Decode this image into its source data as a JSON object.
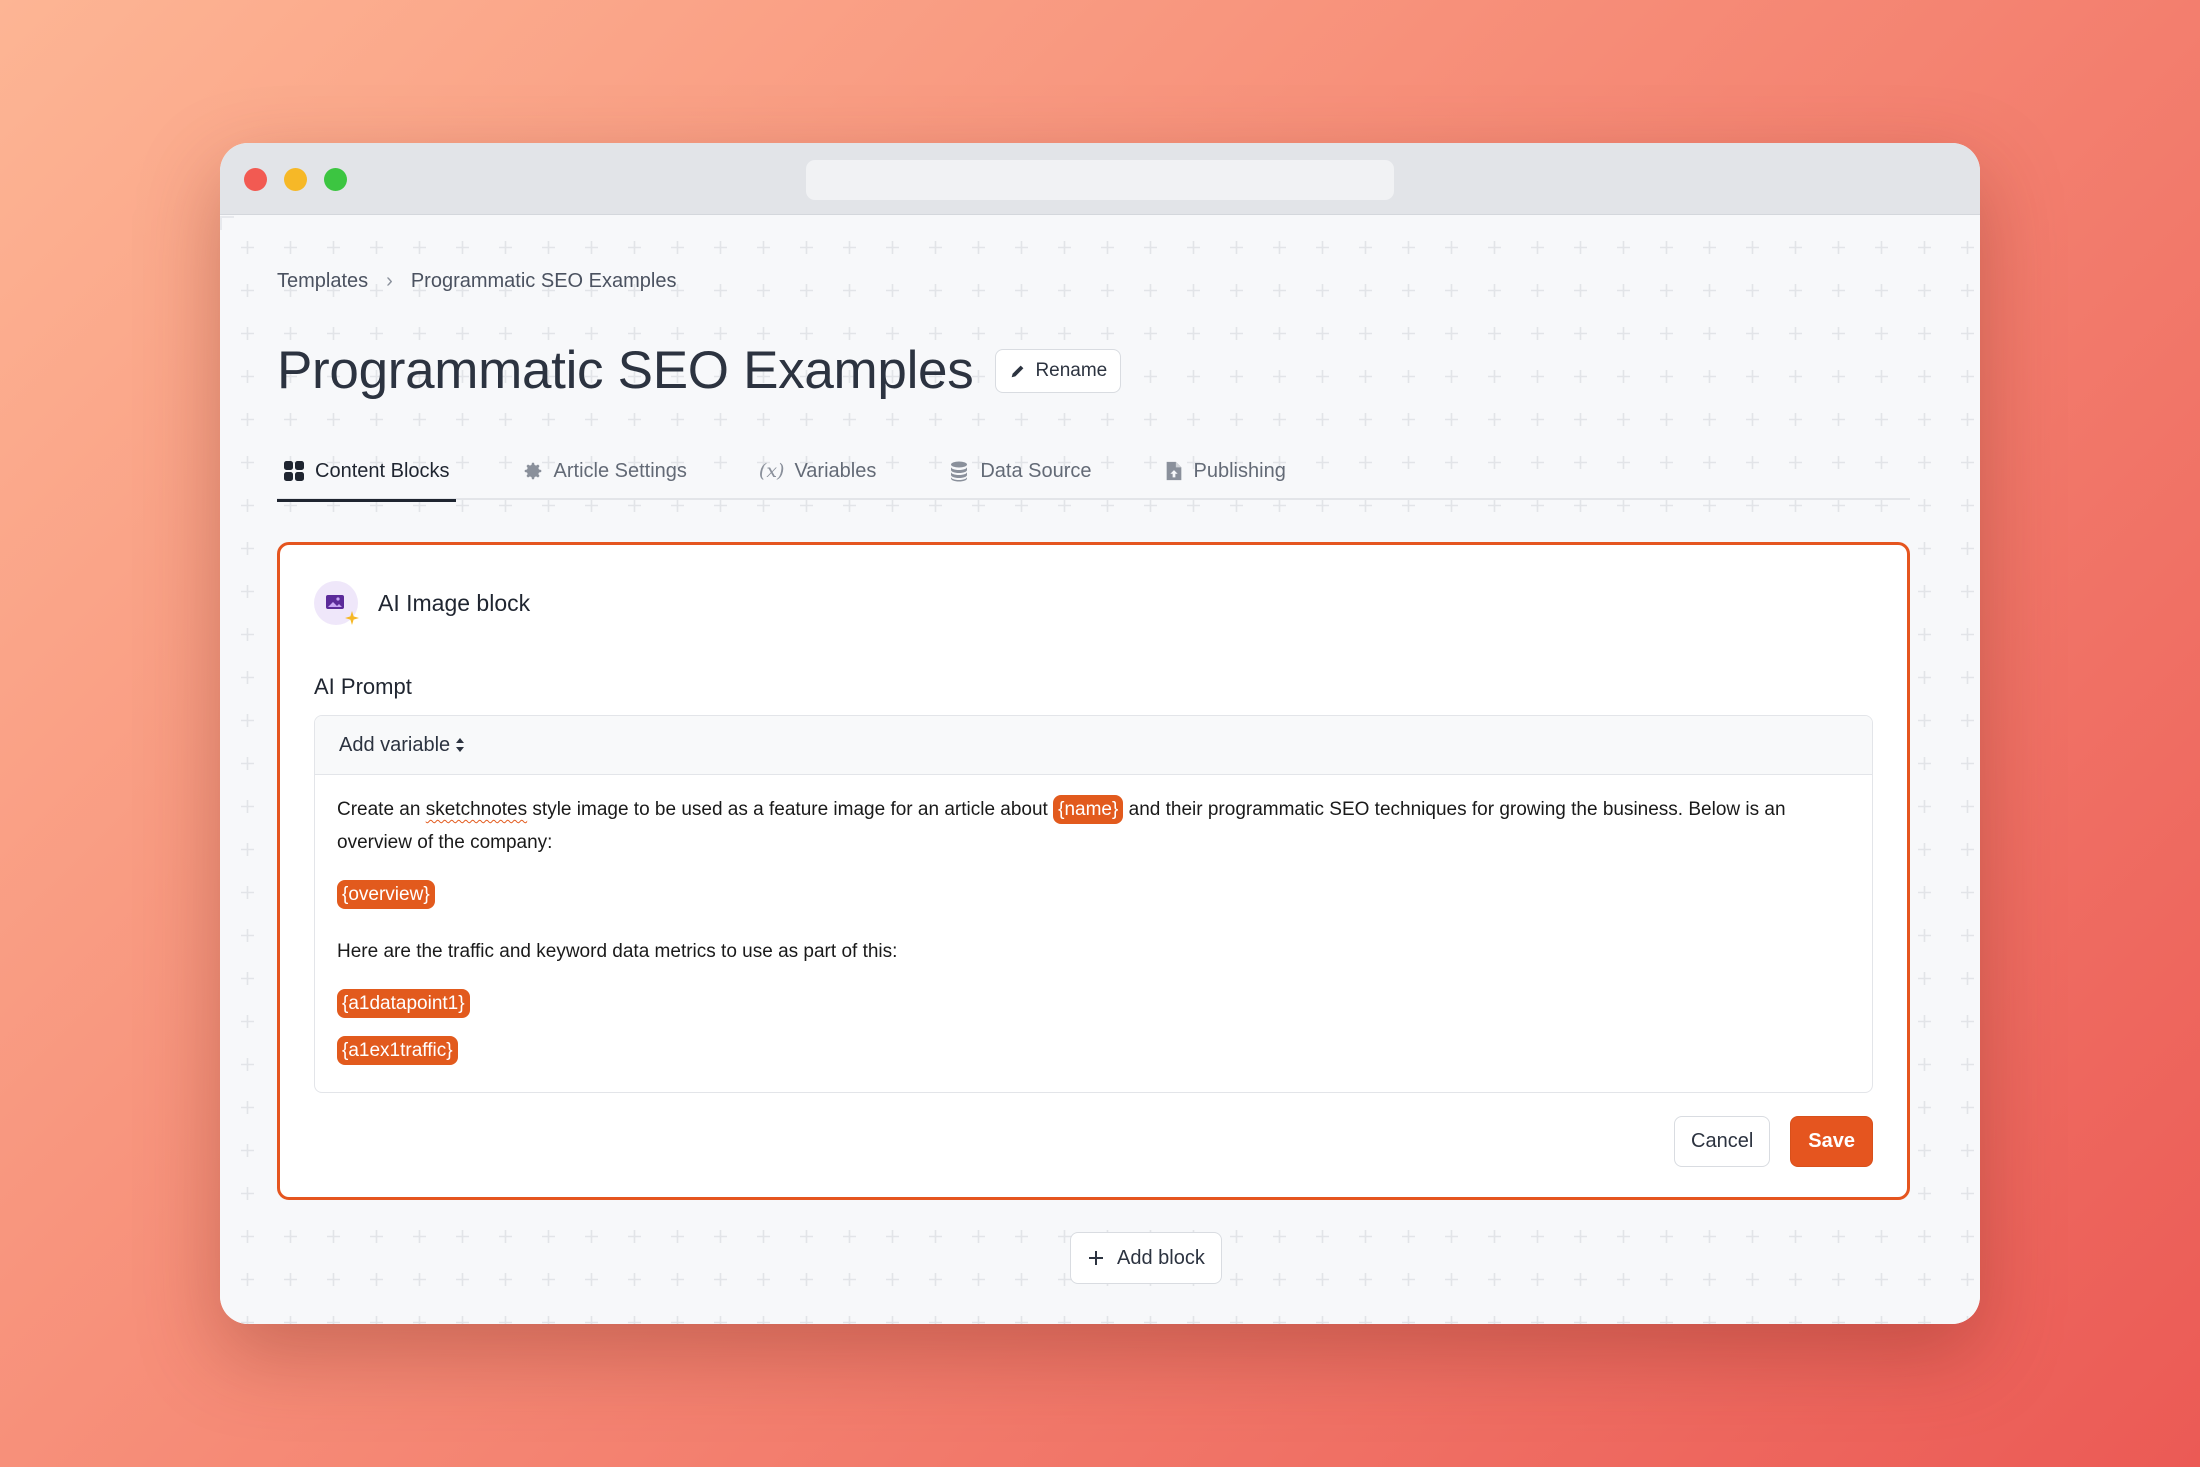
{
  "breadcrumb": {
    "root": "Templates",
    "separator": "›",
    "current": "Programmatic SEO Examples"
  },
  "page": {
    "title": "Programmatic SEO Examples",
    "rename_label": "Rename"
  },
  "tabs": [
    {
      "label": "Content Blocks",
      "icon": "grid-icon",
      "active": true
    },
    {
      "label": "Article Settings",
      "icon": "gear-icon",
      "active": false
    },
    {
      "label": "Variables",
      "icon": "variable-icon",
      "active": false
    },
    {
      "label": "Data Source",
      "icon": "database-icon",
      "active": false
    },
    {
      "label": "Publishing",
      "icon": "document-upload-icon",
      "active": false
    }
  ],
  "block": {
    "title": "AI Image block",
    "prompt_label": "AI Prompt",
    "add_variable_label": "Add variable",
    "prompt": {
      "line1_before": "Create an ",
      "line1_misspelled": "sketchnotes",
      "line1_middle": " style image to be used as a feature image for an article about ",
      "var_name": "{name}",
      "line1_after": " and their programmatic SEO techniques for growing the business. Below is an overview of the company:",
      "var_overview": "{overview}",
      "line2": "Here are the traffic and keyword data metrics to use as part of this:",
      "var_datapoint": "{a1datapoint1}",
      "var_traffic": "{a1ex1traffic}"
    },
    "cancel_label": "Cancel",
    "save_label": "Save"
  },
  "add_block_label": "Add block",
  "colors": {
    "accent": "#e5551f",
    "text": "#2c3340",
    "background": "#f7f8fa"
  }
}
